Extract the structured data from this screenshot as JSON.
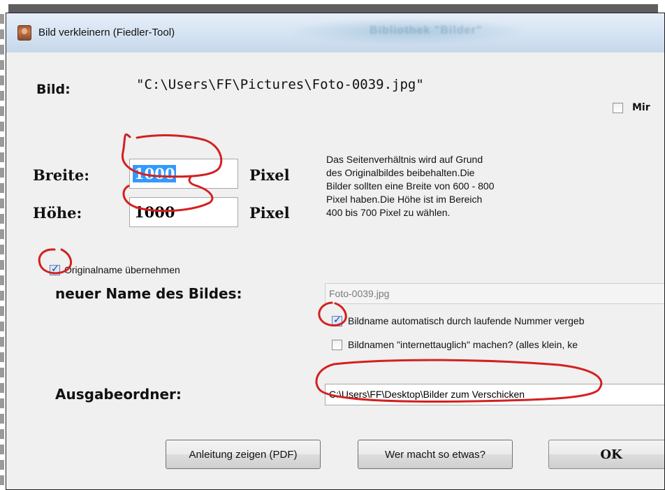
{
  "window": {
    "title": "Bild verkleinern (Fiedler-Tool)",
    "background_title_text": "Bibliothek \"Bilder\""
  },
  "bild": {
    "label": "Bild:",
    "path": "\"C:\\Users\\FF\\Pictures\\Foto-0039.jpg\""
  },
  "mirror": {
    "label": "Mir",
    "checked": false
  },
  "size": {
    "width_label": "Breite:",
    "width_value": "1000",
    "height_label": "Höhe:",
    "height_value": "1000",
    "unit_label": "Pixel"
  },
  "help_text": [
    "Das Seitenverhältnis wird auf Grund",
    "des Originalbildes beibehalten.Die",
    "Bilder sollten eine Breite von 600 - 800",
    "Pixel haben.Die Höhe ist im Bereich",
    "400 bis 700 Pixel zu wählen."
  ],
  "original_name": {
    "label": "Originalname übernehmen",
    "checked": true
  },
  "new_name": {
    "label": "neuer Name des Bildes:",
    "value": "Foto-0039.jpg"
  },
  "auto_number": {
    "label": "Bildname automatisch durch laufende Nummer vergeb",
    "checked": true
  },
  "web_safe": {
    "label": "Bildnamen \"internettauglich\" machen? (alles klein, ke",
    "checked": false
  },
  "output": {
    "label": "Ausgabeordner:",
    "value": "C:\\Users\\FF\\Desktop\\Bilder zum Verschicken"
  },
  "buttons": {
    "manual": "Anleitung zeigen (PDF)",
    "who": "Wer macht so etwas?",
    "ok": "OK"
  },
  "colors": {
    "annotation_red": "#d42020",
    "selection_blue": "#3399ff",
    "dialog_bg": "#f0f0f0"
  }
}
